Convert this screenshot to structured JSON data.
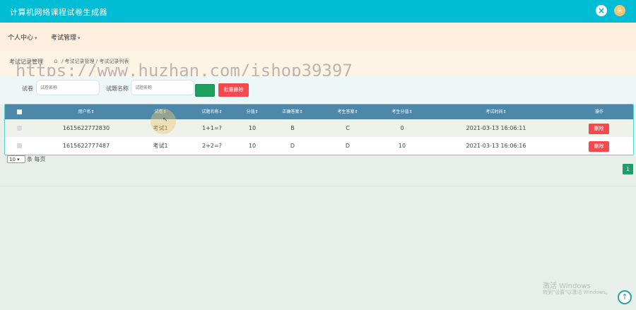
{
  "app": {
    "title": "计算机网络课程试卷生成器",
    "close_icon": "×",
    "avatar_icon": "头"
  },
  "menu": {
    "items": [
      {
        "label": "个人中心"
      },
      {
        "label": "考试管理"
      }
    ],
    "caret": "▾"
  },
  "page": {
    "section_title": "考试记录管理",
    "breadcrumb": [
      "考试记录管理",
      "考试记录列表"
    ],
    "breadcrumb_sep": "/"
  },
  "search": {
    "paper_label": "试卷",
    "paper_placeholder": "试卷名称",
    "question_label": "试题名称",
    "question_placeholder": "试题名称",
    "batch_delete_label": "批量删除"
  },
  "table": {
    "headers": [
      "用户名",
      "试卷",
      "试题名称",
      "分值",
      "正确答案",
      "考生答案",
      "考生分值",
      "考试时间",
      "操作"
    ],
    "sort_mark": "⇕",
    "rows": [
      {
        "username": "1615622772830",
        "paper": "考试1",
        "question": "1+1=?",
        "score": "10",
        "correct": "B",
        "answer": "C",
        "got": "0",
        "time": "2021-03-13 16:06:11",
        "action": "删除"
      },
      {
        "username": "1615622777487",
        "paper": "考试1",
        "question": "2+2=?",
        "score": "10",
        "correct": "D",
        "answer": "D",
        "got": "10",
        "time": "2021-03-13 16:06:16",
        "action": "删除"
      }
    ]
  },
  "pager": {
    "page_size": "10",
    "per_page_text": "条 每页",
    "current_page": "1"
  },
  "overlay": {
    "watermark": "https://www.huzhan.com/ishop39397",
    "windows_line1": "激活 Windows",
    "windows_line2": "转到\"设置\"以激活 Windows。",
    "back_to_top_icon": "↑"
  },
  "colors": {
    "topbar": "#00bcd4",
    "table_header": "#4d87a9",
    "danger": "#f44a4e",
    "primary": "#1ea05f"
  }
}
